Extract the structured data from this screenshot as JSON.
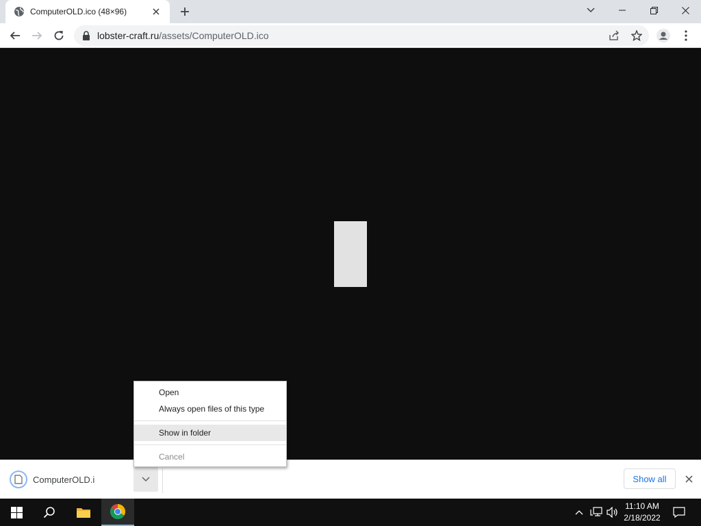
{
  "browser": {
    "tab_title": "ComputerOLD.ico (48×96)",
    "url_host": "lobster-craft.ru",
    "url_path": "/assets/ComputerOLD.ico"
  },
  "download": {
    "file_name": "ComputerOLD.i",
    "show_all_label": "Show all"
  },
  "context_menu": {
    "items": [
      {
        "label": "Open"
      },
      {
        "label": "Always open files of this type"
      },
      {
        "label": "Show in folder"
      },
      {
        "label": "Cancel"
      }
    ]
  },
  "taskbar": {
    "time": "11:10 AM",
    "date": "2/18/2022"
  },
  "colors": {
    "accent": "#1a73e8",
    "content_bg": "#0e0e0e",
    "image_fill": "#e2e2e2"
  }
}
